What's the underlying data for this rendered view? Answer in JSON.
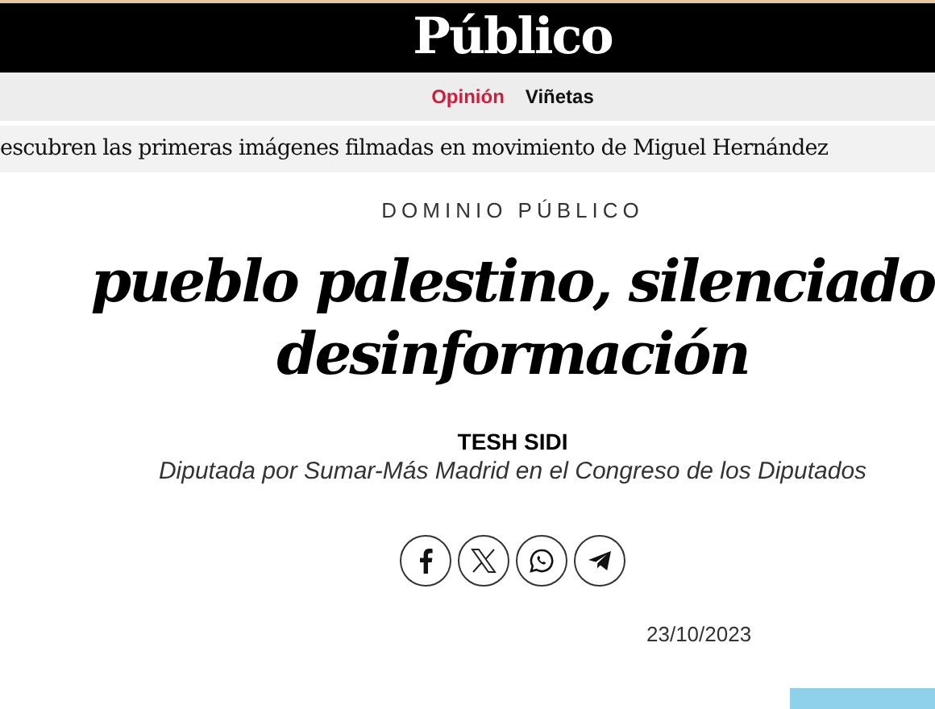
{
  "header": {
    "logo": "Público"
  },
  "nav": [
    {
      "label": "Opinión",
      "selected": true
    },
    {
      "label": "Viñetas",
      "selected": false
    }
  ],
  "ticker": "escubren las primeras imágenes filmadas en movimiento de Miguel Hernández",
  "article": {
    "section": "DOMINIO PÚBLICO",
    "headline": [
      "pueblo palestino, silenciado",
      "desinformación"
    ],
    "author": "TESH SIDI",
    "author_role": "Diputada por Sumar-Más Madrid en el Congreso de los Diputados",
    "share": [
      {
        "kind": "facebook"
      },
      {
        "kind": "x"
      },
      {
        "kind": "whatsapp"
      },
      {
        "kind": "telegram"
      }
    ],
    "date": "23/10/2023"
  }
}
